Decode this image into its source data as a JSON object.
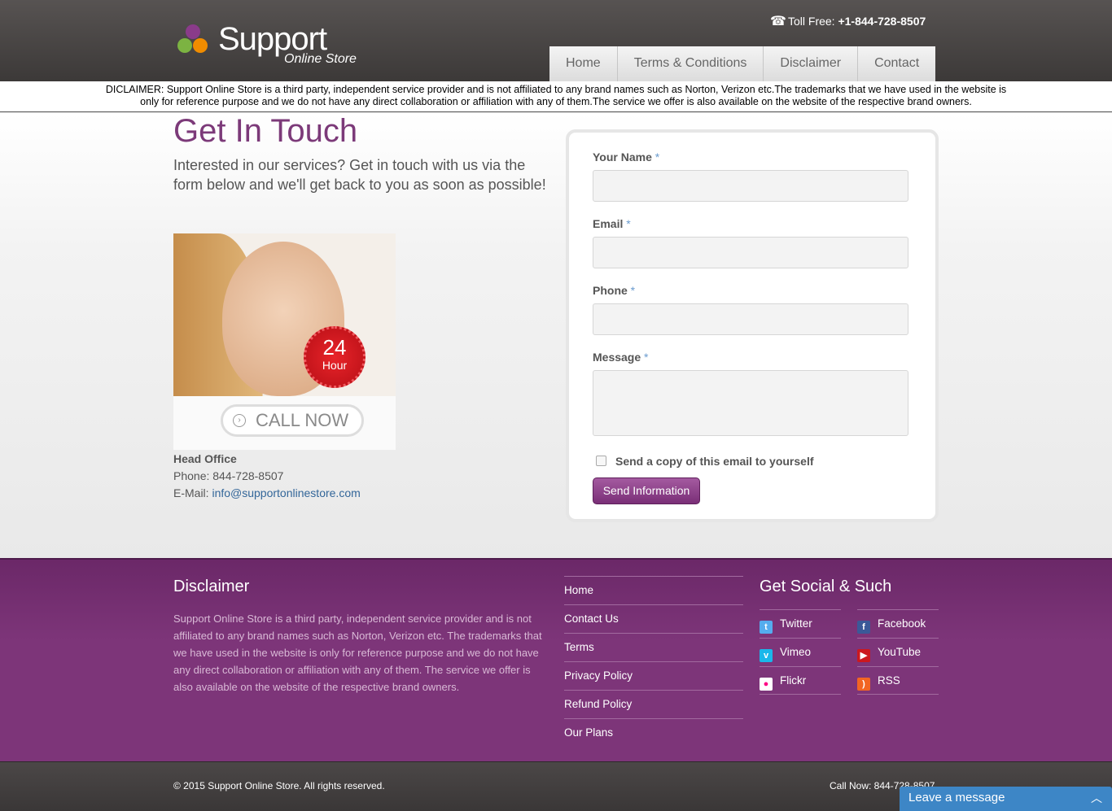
{
  "header": {
    "brand": "Support",
    "brand_sub": "Online Store",
    "toll_free_label": "Toll Free: ",
    "toll_free_number": "+1-844-728-8507",
    "nav": [
      "Home",
      "Terms & Conditions",
      "Disclaimer",
      "Contact"
    ]
  },
  "disclaimer_bar": {
    "line1": "DICLAIMER: Support Online Store is a third party, independent service provider and is not affiliated to any brand names such as Norton, Verizon etc.The trademarks that we have used in the website is",
    "line2": "only for reference purpose and we do not have any direct collaboration or affiliation with any of them.The service we offer is also available on the website of the respective brand owners."
  },
  "main": {
    "title": "Get In Touch",
    "intro": "Interested in our services? Get in touch with us via the form below and we'll get back to you as soon as possible!",
    "promo": {
      "badge_number": "24",
      "badge_text": "Hour",
      "call_now": "CALL NOW"
    },
    "head_office": {
      "title": "Head Office",
      "phone": "Phone: 844-728-8507",
      "email_label": "E-Mail: ",
      "email": "info@supportonlinestore.com"
    }
  },
  "form": {
    "name_label": "Your Name",
    "email_label": "Email",
    "phone_label": "Phone",
    "message_label": "Message",
    "required_mark": "*",
    "copy_label": "Send a copy of this email to yourself",
    "submit": "Send Information"
  },
  "footer": {
    "disclaimer_title": "Disclaimer",
    "disclaimer_text": "Support Online Store is a third party, independent service provider and is not affiliated to any brand names such as Norton, Verizon etc. The trademarks that we have used in the website is only for reference purpose and we do not have any direct collaboration or affiliation with any of them. The service we offer is also available on the website of the respective brand owners.",
    "links": [
      "Home",
      "Contact Us",
      "Terms",
      "Privacy Policy",
      "Refund Policy",
      "Our Plans"
    ],
    "social_title": "Get Social & Such",
    "social": [
      {
        "label": "Twitter",
        "icon": "twitter-icon",
        "color": "#55acee"
      },
      {
        "label": "Facebook",
        "icon": "facebook-icon",
        "color": "#3b5998"
      },
      {
        "label": "Vimeo",
        "icon": "vimeo-icon",
        "color": "#1ab7ea"
      },
      {
        "label": "YouTube",
        "icon": "youtube-icon",
        "color": "#cc181e"
      },
      {
        "label": "Flickr",
        "icon": "flickr-icon",
        "color": "#ff0084"
      },
      {
        "label": "RSS",
        "icon": "rss-icon",
        "color": "#f26522"
      }
    ]
  },
  "bottom": {
    "copyright": "© 2015 Support Online Store. All rights reserved.",
    "call_now": "Call Now: 844-728-8507"
  },
  "chat": {
    "label": "Leave a message"
  },
  "colors": {
    "accent": "#7c3a79",
    "footer": "#7d3579",
    "link": "#336699",
    "chat": "#3d86c6"
  }
}
